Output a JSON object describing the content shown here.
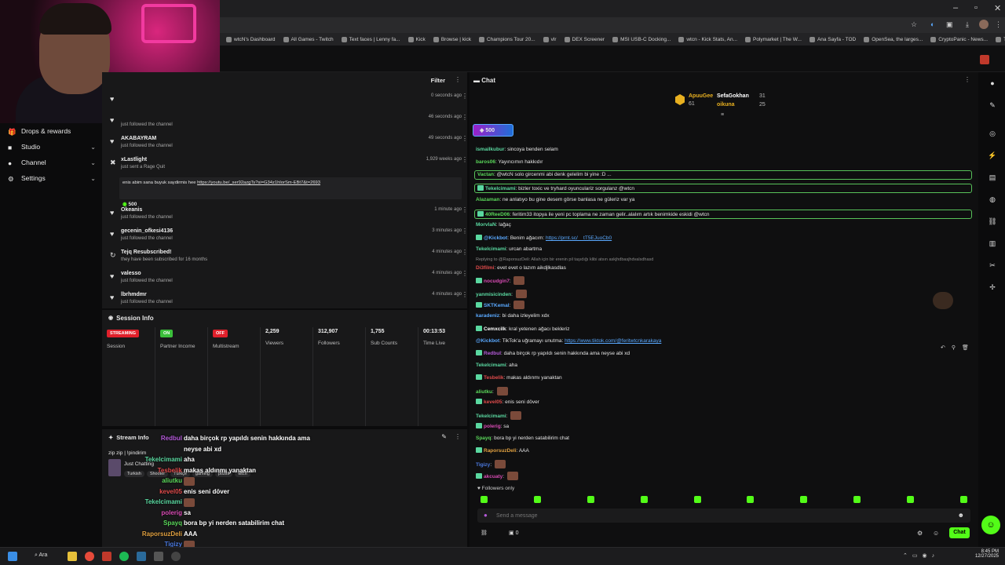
{
  "bookmarks": [
    "wtcN's Dashboard",
    "All Games - Twitch",
    "Text faces | Lenny fa...",
    "Kick",
    "Browse | kick",
    "Champions Tour 20...",
    "vlr",
    "DEX Screener",
    "MSI USB-C Docking...",
    "wtcn - Kick Stats, An...",
    "Polymarket | The W...",
    "Ana Sayfa - TOD",
    "OpenSea, the larges...",
    "CryptoPanic - News...",
    "Tüm Yer İşaretleri"
  ],
  "sidebar": {
    "items": [
      {
        "label": "Drops & rewards",
        "icon": "gift-icon"
      },
      {
        "label": "Studio",
        "icon": "camera-icon",
        "chevron": "⌄"
      },
      {
        "label": "Channel",
        "icon": "user-icon",
        "chevron": "⌄"
      },
      {
        "label": "Settings",
        "icon": "gear-icon",
        "chevron": "⌄"
      }
    ]
  },
  "activity": {
    "filter_label": "Filter",
    "items": [
      {
        "name": "",
        "sub": "",
        "time": "0 seconds ago"
      },
      {
        "name": "",
        "sub": "just followed the channel",
        "time": "46 seconds ago"
      },
      {
        "name": "AKABAYRAM",
        "sub": "just followed the channel",
        "time": "49 seconds ago"
      },
      {
        "name": "xLastlight",
        "sub": "just sent a Rage Quit",
        "time": "1,929 weeks ago",
        "message": "enis abim sana buyuk saydirmis hee",
        "link": "https://youtu.be/_ser92azgTs?si=G34z1hIorSm-EBt7&t=2693",
        "amount": "500"
      },
      {
        "name": "Okeanis",
        "sub": "just followed the channel",
        "time": "1 minute ago"
      },
      {
        "name": "gecenin_ofkesi4136",
        "sub": "just followed the channel",
        "time": "3 minutes ago"
      },
      {
        "name": "Tejq Resubscribed!",
        "sub": "they have been subscribed for 16 months",
        "time": "4 minutes ago"
      },
      {
        "name": "valesso",
        "sub": "just followed the channel",
        "time": "4 minutes ago"
      },
      {
        "name": "lbrhmdmr",
        "sub": "just followed the channel",
        "time": "4 minutes ago"
      }
    ]
  },
  "session": {
    "title": "Session Info",
    "cols": [
      {
        "pill": "STREAMING",
        "pill_color": "#e0202b",
        "label": "Session"
      },
      {
        "pill": "ON",
        "pill_color": "#3bbf3b",
        "label": "Partner Income"
      },
      {
        "pill": "OFF",
        "pill_color": "#e0202b",
        "label": "Multistream"
      },
      {
        "value": "2,259",
        "label": "Viewers"
      },
      {
        "value": "312,907",
        "label": "Followers"
      },
      {
        "value": "1,755",
        "label": "Sub Counts"
      },
      {
        "value": "00:13:53",
        "label": "Time Live"
      }
    ]
  },
  "streaminfo": {
    "title": "Stream Info",
    "stream_title": "zip zip | !pindirim",
    "category": "Just Chatting",
    "tags": [
      "Turkish",
      "Shooter",
      "Türkçe",
      "gaming",
      "pozitif",
      "wtcn"
    ]
  },
  "overlay_chat": [
    {
      "user": "Redbul",
      "color": "#b45ad8",
      "text": "daha birçok rp yapıldı senin hakkında ama"
    },
    {
      "user": "",
      "color": "#fff",
      "text": "neyse abi xd"
    },
    {
      "user": "Tekelcimami",
      "color": "#5ad8a0",
      "text": "aha"
    },
    {
      "user": "Tesbelik",
      "color": "#e04b4b",
      "text": "makas aldınmı yanaktan"
    },
    {
      "user": "aliutku",
      "color": "#5ad85a",
      "text": ""
    },
    {
      "user": "kevel05",
      "color": "#e04b4b",
      "text": "enis seni döver"
    },
    {
      "user": "Tekelcimami",
      "color": "#5ad8a0",
      "text": ""
    },
    {
      "user": "polerig",
      "color": "#d84bb4",
      "text": "sa"
    },
    {
      "user": "Spayq",
      "color": "#5ad85a",
      "text": "bora bp yi nerden satabilirim chat"
    },
    {
      "user": "RaporsuzDeli",
      "color": "#e0a040",
      "text": "AAA"
    },
    {
      "user": "Tigizy",
      "color": "#4b7ae0",
      "text": ""
    }
  ],
  "chat": {
    "title": "Chat",
    "leaders": [
      {
        "name": "ApuuGee",
        "amount": "61",
        "color": "#e8b020"
      },
      {
        "name": "SefaGokhan",
        "amount": "31",
        "color": "#ffffff"
      },
      {
        "name": "oikuna",
        "amount": "25",
        "color": "#e8b020"
      }
    ],
    "goal": "500",
    "messages": [
      {
        "user": "ismailkubur",
        "color": "#5ad8a0",
        "text": "sincoya benden selam"
      },
      {
        "user": "baros06",
        "color": "#5ad85a",
        "text": "Yayıncımın hakkıdır"
      },
      {
        "user": "Vactan",
        "color": "#5ad85a",
        "text": "@wtcN solo gircenmi abi denk gelelim bi yine :D ...",
        "hl": true
      },
      {
        "user": "Tekelcimami",
        "color": "#5ad8a0",
        "text": "bizler toxic ve tryhard oyunculariz sorgulanz @wtcn",
        "hl": true
      },
      {
        "user": "Alazaman",
        "color": "#5ad85a",
        "text": "ne anlatıyo bu gine desem görse banlasa ne güleriz var ya"
      },
      {
        "user": "40ReeD06",
        "color": "#5ad85a",
        "text": "feritim33 itopya ile yeni pc toplama ne zaman gelir..alalım artık benimkide eskidi @wtcn",
        "hl": true
      },
      {
        "user": "MorvlaN",
        "color": "#5ad8a0",
        "text": "lağaç"
      },
      {
        "user": "@Kickbot",
        "color": "#5aa9ff",
        "text": "Benim ağacım: ",
        "link": "https://prnt.sc/__tT5EJuoCb0"
      },
      {
        "user": "Tekelcimami",
        "color": "#5ad8a0",
        "text": "urcan abartma"
      },
      {
        "user": "",
        "color": "#888",
        "text": "Replying to @RaporsuzDeli: Allah için bir erenin pil taşıdığı klibi atsın askjhdbasjhdvalsdhasd",
        "reply": true
      },
      {
        "user": "Di3filmi",
        "color": "#e04b4b",
        "text": "evet evet o lazım aikdjlkasdlas"
      },
      {
        "user": "nocudgin7",
        "color": "#d84bb4",
        "text": ""
      },
      {
        "user": "yanmisicinden",
        "color": "#5ad8a0",
        "text": ""
      },
      {
        "user": "SKTKemal",
        "color": "#5aa9ff",
        "text": ""
      },
      {
        "user": "karadeniz",
        "color": "#5aa9ff",
        "text": "bi daha izleyelim xdx"
      },
      {
        "user": "Cemxcilk",
        "color": "#ffffff",
        "text": "kral yetenen ağacı bekleriz"
      },
      {
        "user": "@Kickbot",
        "color": "#5aa9ff",
        "text": "TikTok'a uğramayı unutma: ",
        "link": "https://www.tiktok.com/@feritwtcnkarakaya"
      },
      {
        "user": "Redbul",
        "color": "#b45ad8",
        "text": "daha birçok rp yapıldı senin hakkında ama neyse abi xd"
      },
      {
        "user": "Tekelcimami",
        "color": "#5ad8a0",
        "text": "aha"
      },
      {
        "user": "Tesbelik",
        "color": "#e04b4b",
        "text": "makas aldınmı yanaktan"
      },
      {
        "user": "aliutku",
        "color": "#5ad85a",
        "text": ""
      },
      {
        "user": "kevel05",
        "color": "#e04b4b",
        "text": "enis seni döver"
      },
      {
        "user": "Tekelcimami",
        "color": "#5ad8a0",
        "text": ""
      },
      {
        "user": "polerig",
        "color": "#d84bb4",
        "text": "sa"
      },
      {
        "user": "Spayq",
        "color": "#5ad85a",
        "text": "bora bp yi nerden satabilirim chat"
      },
      {
        "user": "RaporsuzDeli",
        "color": "#e0a040",
        "text": "AAA"
      },
      {
        "user": "Tigizy",
        "color": "#4b7ae0",
        "text": ""
      },
      {
        "user": "akcuaty",
        "color": "#d84bb4",
        "text": ""
      }
    ],
    "followers_only": "Followers only",
    "input_placeholder": "Send a message",
    "footer_count": "0",
    "send_label": "Chat"
  },
  "taskbar": {
    "search_label": "Ara",
    "time": "8:45 PM",
    "date": "12/27/2025"
  }
}
